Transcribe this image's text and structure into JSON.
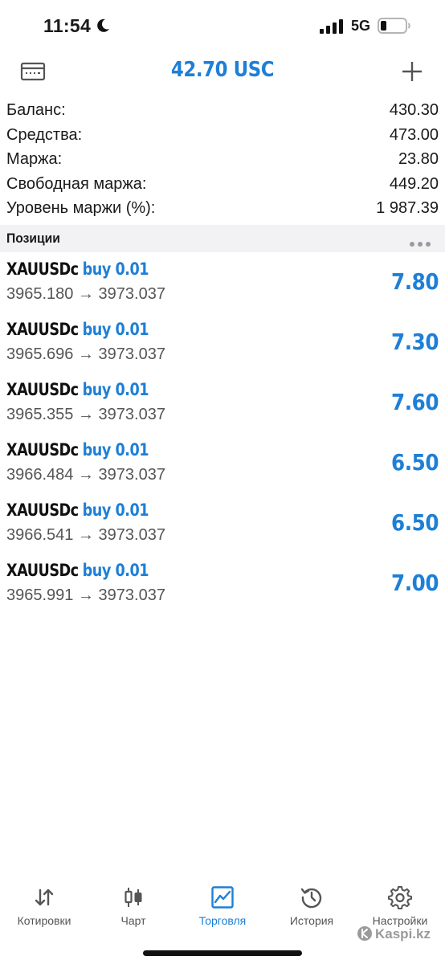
{
  "status_bar": {
    "time": "11:54",
    "network": "5G"
  },
  "header": {
    "title": "42.70 USC"
  },
  "summary": [
    {
      "label": "Баланс:",
      "value": "430.30"
    },
    {
      "label": "Средства:",
      "value": "473.00"
    },
    {
      "label": "Маржа:",
      "value": "23.80"
    },
    {
      "label": "Свободная маржа:",
      "value": "449.20"
    },
    {
      "label": "Уровень маржи (%):",
      "value": "1 987.39"
    }
  ],
  "positions_section": {
    "title": "Позиции"
  },
  "positions": [
    {
      "symbol": "XAUUSDc",
      "type": "buy 0.01",
      "prices": "3965.180 → 3973.037",
      "profit": "7.80"
    },
    {
      "symbol": "XAUUSDc",
      "type": "buy 0.01",
      "prices": "3965.696 → 3973.037",
      "profit": "7.30"
    },
    {
      "symbol": "XAUUSDc",
      "type": "buy 0.01",
      "prices": "3965.355 → 3973.037",
      "profit": "7.60"
    },
    {
      "symbol": "XAUUSDc",
      "type": "buy 0.01",
      "prices": "3966.484 → 3973.037",
      "profit": "6.50"
    },
    {
      "symbol": "XAUUSDc",
      "type": "buy 0.01",
      "prices": "3966.541 → 3973.037",
      "profit": "6.50"
    },
    {
      "symbol": "XAUUSDc",
      "type": "buy 0.01",
      "prices": "3965.991 → 3973.037",
      "profit": "7.00"
    }
  ],
  "tabs": [
    {
      "label": "Котировки",
      "icon": "quotes-arrows-icon"
    },
    {
      "label": "Чарт",
      "icon": "candlestick-chart-icon"
    },
    {
      "label": "Торговля",
      "icon": "trade-chart-icon",
      "active": true
    },
    {
      "label": "История",
      "icon": "history-clock-icon"
    },
    {
      "label": "Настройки",
      "icon": "gear-icon"
    }
  ],
  "watermark": {
    "text": "Kaspi.kz"
  },
  "colors": {
    "accent": "#1e7fd6",
    "text": "#1a1a1a",
    "muted": "#555555",
    "section_bg": "#f2f2f4"
  }
}
